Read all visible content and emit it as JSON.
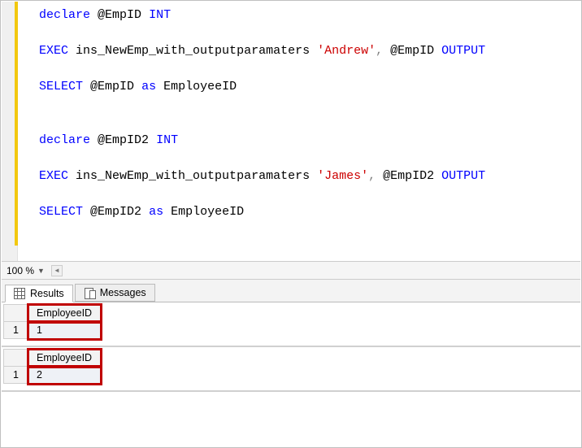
{
  "editor": {
    "zoom": "100 %",
    "code": {
      "l1_declare": "declare",
      "l1_var": "@EmpID",
      "l1_type": "INT",
      "l2_exec": "EXEC",
      "l2_proc": "ins_NewEmp_with_outputparamaters",
      "l2_str": "'Andrew'",
      "l2_var": "@EmpID",
      "l2_output": "OUTPUT",
      "l3_select": "SELECT",
      "l3_var": "@EmpID",
      "l3_as": "as",
      "l3_alias": "EmployeeID",
      "l4_declare": "declare",
      "l4_var": "@EmpID2",
      "l4_type": "INT",
      "l5_exec": "EXEC",
      "l5_proc": "ins_NewEmp_with_outputparamaters",
      "l5_str": "'James'",
      "l5_var": "@EmpID2",
      "l5_output": "OUTPUT",
      "l6_select": "SELECT",
      "l6_var": "@EmpID2",
      "l6_as": "as",
      "l6_alias": "EmployeeID"
    }
  },
  "tabs": {
    "results": "Results",
    "messages": "Messages"
  },
  "results": [
    {
      "columns": [
        "EmployeeID"
      ],
      "rows": [
        {
          "rownum": "1",
          "cells": [
            "1"
          ]
        }
      ]
    },
    {
      "columns": [
        "EmployeeID"
      ],
      "rows": [
        {
          "rownum": "1",
          "cells": [
            "2"
          ]
        }
      ]
    }
  ]
}
